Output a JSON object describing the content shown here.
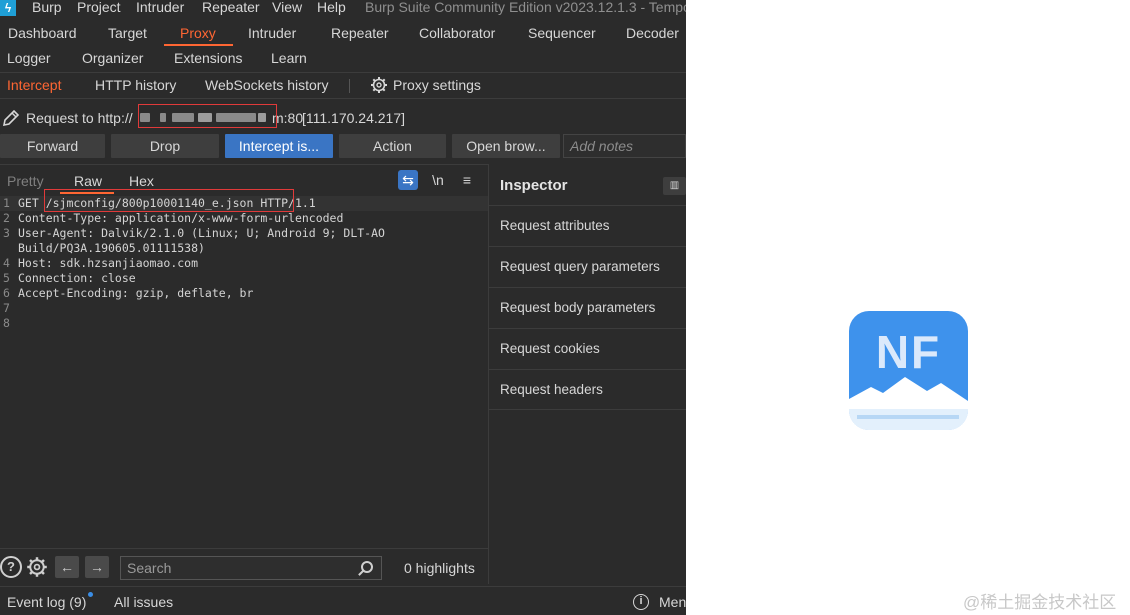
{
  "window": {
    "title": "Burp Suite Community Edition v2023.12.1.3 - Tempo",
    "menu": [
      "Burp",
      "Project",
      "Intruder",
      "Repeater",
      "View",
      "Help"
    ]
  },
  "tabs_row1": [
    "Dashboard",
    "Target",
    "Proxy",
    "Intruder",
    "Repeater",
    "Collaborator",
    "Sequencer",
    "Decoder"
  ],
  "tabs_row2": [
    "Logger",
    "Organizer",
    "Extensions",
    "Learn"
  ],
  "active_tab": "Proxy",
  "proxy_subtabs": [
    "Intercept",
    "HTTP history",
    "WebSockets history"
  ],
  "proxy_settings_label": "Proxy settings",
  "request_bar": {
    "prefix": "Request to http://",
    "port": "m:80",
    "ip": "[111.170.24.217]"
  },
  "buttons": {
    "forward": "Forward",
    "drop": "Drop",
    "intercept": "Intercept is...",
    "action": "Action",
    "open_browser": "Open brow...",
    "notes_placeholder": "Add notes"
  },
  "editor_tabs": {
    "pretty": "Pretty",
    "raw": "Raw",
    "hex": "Hex",
    "newline": "\\n"
  },
  "request_lines": [
    {
      "n": "1",
      "text": "GET /sjmconfig/800p10001140_e.json HTTP/1.1"
    },
    {
      "n": "2",
      "text": "Content-Type: application/x-www-form-urlencoded"
    },
    {
      "n": "3",
      "text": "User-Agent: Dalvik/2.1.0 (Linux; U; Android 9; DLT-AO"
    },
    {
      "n": "",
      "text": "Build/PQ3A.190605.01111538)"
    },
    {
      "n": "4",
      "text": "Host: sdk.hzsanjiaomao.com"
    },
    {
      "n": "5",
      "text": "Connection: close"
    },
    {
      "n": "6",
      "text": "Accept-Encoding: gzip, deflate, br"
    },
    {
      "n": "7",
      "text": ""
    },
    {
      "n": "8",
      "text": ""
    }
  ],
  "inspector": {
    "title": "Inspector",
    "items": [
      "Request attributes",
      "Request query parameters",
      "Request body parameters",
      "Request cookies",
      "Request headers"
    ]
  },
  "bottom": {
    "search_placeholder": "Search",
    "highlights": "0 highlights"
  },
  "status": {
    "event_log": "Event log (9)",
    "all_issues": "All issues",
    "memory": "Men"
  },
  "logo": {
    "text": "NF"
  },
  "watermark": "@稀土掘金技术社区",
  "colors": {
    "accent": "#ff6633",
    "primary_button": "#3a75c4",
    "highlight_box": "#e03a3a",
    "logo_bg": "#3e92ec"
  }
}
